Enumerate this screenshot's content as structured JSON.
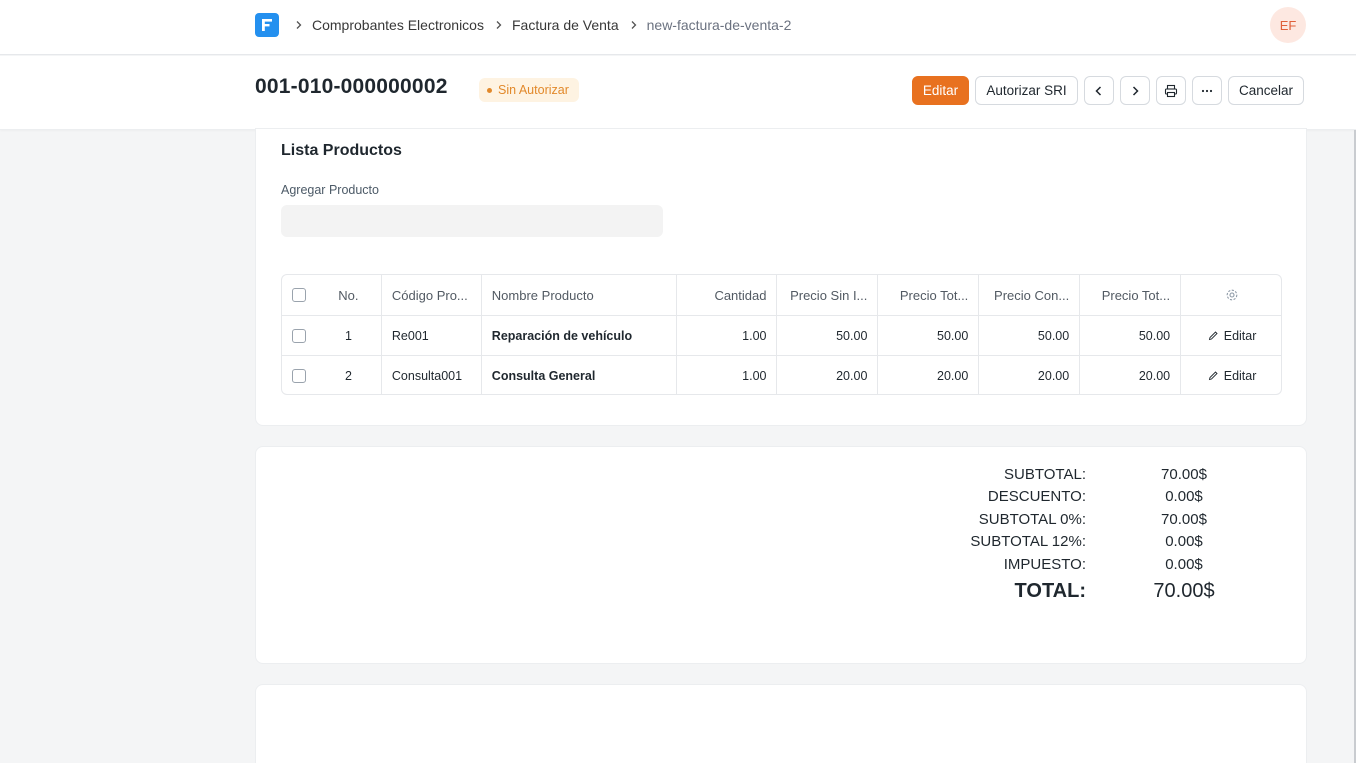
{
  "nav": {
    "breadcrumbs": [
      "Comprobantes Electronicos",
      "Factura de Venta",
      "new-factura-de-venta-2"
    ],
    "avatar_initials": "EF"
  },
  "header": {
    "title": "001-010-000000002",
    "status": "Sin Autorizar",
    "status_color": "#e2892b",
    "buttons": {
      "edit": "Editar",
      "authorize": "Autorizar SRI",
      "prev_icon": "chevron-left-icon",
      "next_icon": "chevron-right-icon",
      "print_icon": "printer-icon",
      "more_icon": "more-horizontal-icon",
      "cancel": "Cancelar"
    },
    "accent_color": "#e8711f"
  },
  "products": {
    "section_title": "Lista Productos",
    "add_label": "Agregar Producto",
    "add_value": "",
    "columns": [
      "No.",
      "Código Pro...",
      "Nombre Producto",
      "Cantidad",
      "Precio Sin I...",
      "Precio Tot...",
      "Precio Con...",
      "Precio Tot..."
    ],
    "settings_icon": "gear-icon",
    "rows": [
      {
        "no": "1",
        "code": "Re001",
        "name": "Reparación de vehículo",
        "qty": "1.00",
        "price_no_tax": "50.00",
        "total_no_tax": "50.00",
        "price_tax": "50.00",
        "total_tax": "50.00",
        "action": "Editar"
      },
      {
        "no": "2",
        "code": "Consulta001",
        "name": "Consulta General",
        "qty": "1.00",
        "price_no_tax": "20.00",
        "total_no_tax": "20.00",
        "price_tax": "20.00",
        "total_tax": "20.00",
        "action": "Editar"
      }
    ]
  },
  "totals": {
    "subtotal_label": "SUBTOTAL:",
    "subtotal": "70.00$",
    "discount_label": "DESCUENTO:",
    "discount": "0.00$",
    "subtotal0_label": "SUBTOTAL 0%:",
    "subtotal0": "70.00$",
    "subtotal12_label": "SUBTOTAL 12%:",
    "subtotal12": "0.00$",
    "tax_label": "IMPUESTO:",
    "tax": "0.00$",
    "total_label": "TOTAL:",
    "total": "70.00$"
  }
}
